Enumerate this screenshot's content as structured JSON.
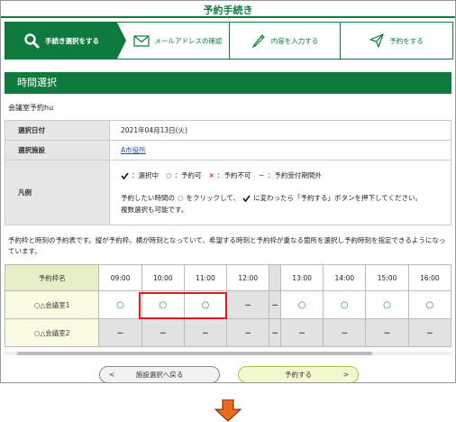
{
  "page_title": "予約手続き",
  "steps": [
    {
      "label": "手続き選択をする",
      "icon": "search-icon"
    },
    {
      "label": "メールアドレスの確認",
      "icon": "envelope-icon"
    },
    {
      "label": "内容を入力する",
      "icon": "pencil-icon"
    },
    {
      "label": "予約をする",
      "icon": "paper-plane-icon"
    }
  ],
  "section_title": "時間選択",
  "facility_name": "会議室予約hu",
  "info": {
    "date_label": "選択日付",
    "date_value": "2021年04月13日(火)",
    "facility_label": "選択施設",
    "facility_value": "A市役所",
    "legend_label": "凡例",
    "legend": {
      "selected_text": "：選択中",
      "available_mark": "○",
      "available_text": "：予約可",
      "unavailable_mark": "×",
      "unavailable_text": "：予約不可",
      "outside_mark": "－",
      "outside_text": "：予約受付期間外",
      "instruction_a": "予約したい時間の",
      "instruction_b": "をクリックして、",
      "instruction_c": "に変わったら「予約する」ボタンを押下してください。",
      "instruction_2": "複数選択も可能です。"
    }
  },
  "note": "予約枠と時刻の予約表です。縦が予約枠、横が時刻となっていて、希望する時刻と予約枠が重なる箇所を選択し予約時刻を指定できるようになっています。",
  "grid": {
    "header_label": "予約枠名",
    "times": [
      "09:00",
      "10:00",
      "11:00",
      "12:00",
      "13:00",
      "14:00",
      "15:00",
      "16:00"
    ],
    "rows": [
      {
        "name": "○△会議室1",
        "cells": [
          "○",
          "○",
          "○",
          "－",
          "－",
          "○",
          "○",
          "○",
          "○"
        ]
      },
      {
        "name": "○△会議室2",
        "cells": [
          "－",
          "－",
          "－",
          "－",
          "－",
          "－",
          "－",
          "－",
          "－"
        ]
      }
    ]
  },
  "buttons": {
    "back": "施設選択へ戻る",
    "reserve": "予約する"
  },
  "colors": {
    "brand_green": "#0e7a3e",
    "highlight_red": "#e2191d",
    "arrow_orange": "#ec6a1e"
  }
}
